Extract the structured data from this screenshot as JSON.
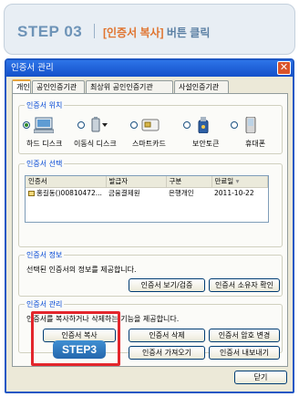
{
  "header": {
    "step": "STEP 03",
    "caption_bracket": "[인증서 복사]",
    "caption_rest": " 버튼 클릭"
  },
  "window": {
    "title": "인증서 관리",
    "close_symbol": "✕"
  },
  "tabs": [
    "개인",
    "공인인증기관",
    "최상위 공인인증기관",
    "사설인증기관"
  ],
  "location": {
    "label": "인증서 위치",
    "items": [
      {
        "label": "하드 디스크",
        "icon": "hard-disk-icon",
        "selected": true
      },
      {
        "label": "이동식 디스크",
        "icon": "removable-disk-icon",
        "selected": false
      },
      {
        "label": "스마트카드",
        "icon": "smartcard-icon",
        "selected": false
      },
      {
        "label": "보안토큰",
        "icon": "security-token-icon",
        "selected": false
      },
      {
        "label": "휴대폰",
        "icon": "mobile-phone-icon",
        "selected": false
      }
    ]
  },
  "select": {
    "label": "인증서 선택",
    "columns": [
      "인증서",
      "발급자",
      "구분",
      "만료일"
    ],
    "rows": [
      [
        "홍길동()00810472...",
        "금융결제원",
        "은행개인",
        "2011-10-22"
      ]
    ]
  },
  "info": {
    "label": "인증서 정보",
    "text": "선택된 인증서의 정보를 제공합니다.",
    "view_button": "인증서 보기/검증",
    "owner_button": "인증서 소유자 확인"
  },
  "manage": {
    "label": "인증서 관리",
    "text": "인증서를 복사하거나 삭제하는 기능을 제공합니다.",
    "copy_button": "인증서 복사",
    "delete_button": "인증서 삭제",
    "password_button": "인증서 암호 변경",
    "import_button": "인증서 가져오기",
    "export_button": "인증서 내보내기"
  },
  "close_button": "닫기",
  "callout": "STEP3",
  "colors": {
    "titlebar": "#1450c9",
    "highlight": "#e3262c",
    "badge": "#2567ad"
  }
}
